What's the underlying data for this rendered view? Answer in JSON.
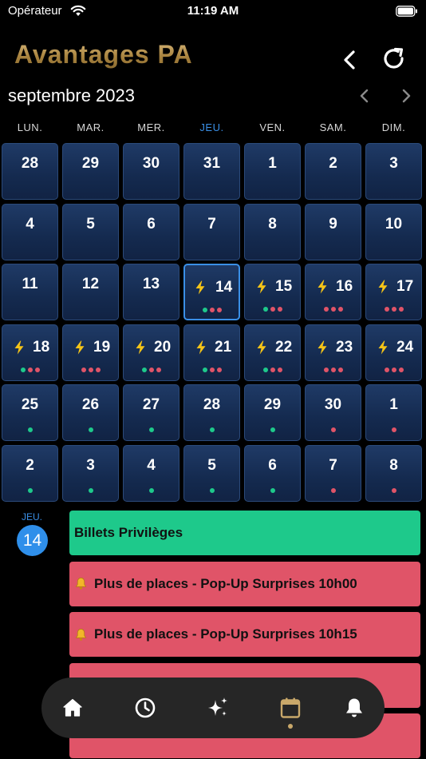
{
  "status": {
    "carrier": "Opérateur",
    "time": "11:19 AM"
  },
  "header": {
    "title": "Avantages PA"
  },
  "calendar": {
    "month_label": "septembre 2023",
    "weekdays": [
      "LUN.",
      "MAR.",
      "MER.",
      "JEU.",
      "VEN.",
      "SAM.",
      "DIM."
    ],
    "today_index": 3,
    "weeks": [
      [
        {
          "d": "28",
          "b": 0,
          "dots": []
        },
        {
          "d": "29",
          "b": 0,
          "dots": []
        },
        {
          "d": "30",
          "b": 0,
          "dots": []
        },
        {
          "d": "31",
          "b": 0,
          "dots": []
        },
        {
          "d": "1",
          "b": 0,
          "dots": []
        },
        {
          "d": "2",
          "b": 0,
          "dots": []
        },
        {
          "d": "3",
          "b": 0,
          "dots": []
        }
      ],
      [
        {
          "d": "4",
          "b": 0,
          "dots": []
        },
        {
          "d": "5",
          "b": 0,
          "dots": []
        },
        {
          "d": "6",
          "b": 0,
          "dots": []
        },
        {
          "d": "7",
          "b": 0,
          "dots": []
        },
        {
          "d": "8",
          "b": 0,
          "dots": []
        },
        {
          "d": "9",
          "b": 0,
          "dots": []
        },
        {
          "d": "10",
          "b": 0,
          "dots": []
        }
      ],
      [
        {
          "d": "11",
          "b": 0,
          "dots": []
        },
        {
          "d": "12",
          "b": 0,
          "dots": []
        },
        {
          "d": "13",
          "b": 0,
          "dots": []
        },
        {
          "d": "14",
          "b": 1,
          "sel": 1,
          "dots": [
            "g",
            "r",
            "r"
          ]
        },
        {
          "d": "15",
          "b": 1,
          "dots": [
            "g",
            "r",
            "r"
          ]
        },
        {
          "d": "16",
          "b": 1,
          "dots": [
            "r",
            "r",
            "r"
          ]
        },
        {
          "d": "17",
          "b": 1,
          "dots": [
            "r",
            "r",
            "r"
          ]
        }
      ],
      [
        {
          "d": "18",
          "b": 1,
          "dots": [
            "g",
            "r",
            "r"
          ]
        },
        {
          "d": "19",
          "b": 1,
          "dots": [
            "r",
            "r",
            "r"
          ]
        },
        {
          "d": "20",
          "b": 1,
          "dots": [
            "g",
            "r",
            "r"
          ]
        },
        {
          "d": "21",
          "b": 1,
          "dots": [
            "g",
            "r",
            "r"
          ]
        },
        {
          "d": "22",
          "b": 1,
          "dots": [
            "g",
            "r",
            "r"
          ]
        },
        {
          "d": "23",
          "b": 1,
          "dots": [
            "r",
            "r",
            "r"
          ]
        },
        {
          "d": "24",
          "b": 1,
          "dots": [
            "r",
            "r",
            "r"
          ]
        }
      ],
      [
        {
          "d": "25",
          "b": 0,
          "dots": [
            "g"
          ]
        },
        {
          "d": "26",
          "b": 0,
          "dots": [
            "g"
          ]
        },
        {
          "d": "27",
          "b": 0,
          "dots": [
            "g"
          ]
        },
        {
          "d": "28",
          "b": 0,
          "dots": [
            "g"
          ]
        },
        {
          "d": "29",
          "b": 0,
          "dots": [
            "g"
          ]
        },
        {
          "d": "30",
          "b": 0,
          "dots": [
            "r"
          ]
        },
        {
          "d": "1",
          "b": 0,
          "dots": [
            "r"
          ]
        }
      ],
      [
        {
          "d": "2",
          "b": 0,
          "dots": [
            "g"
          ]
        },
        {
          "d": "3",
          "b": 0,
          "dots": [
            "g"
          ]
        },
        {
          "d": "4",
          "b": 0,
          "dots": [
            "g"
          ]
        },
        {
          "d": "5",
          "b": 0,
          "dots": [
            "g"
          ]
        },
        {
          "d": "6",
          "b": 0,
          "dots": [
            "g"
          ]
        },
        {
          "d": "7",
          "b": 0,
          "dots": [
            "r"
          ]
        },
        {
          "d": "8",
          "b": 0,
          "dots": [
            "r"
          ]
        }
      ]
    ]
  },
  "selected_day": {
    "weekday": "JEU.",
    "day": "14"
  },
  "events": [
    {
      "title": "Billets Privilèges",
      "color": "green",
      "icon": ""
    },
    {
      "title": "Plus de places - Pop-Up Surprises 10h00",
      "color": "red",
      "icon": "bell-icon"
    },
    {
      "title": "Plus de places - Pop-Up Surprises 10h15",
      "color": "red",
      "icon": "bell-icon"
    },
    {
      "title": "",
      "color": "red",
      "icon": ""
    },
    {
      "title": "",
      "color": "red",
      "icon": ""
    }
  ],
  "tabs": [
    {
      "name": "home-icon"
    },
    {
      "name": "clock-icon"
    },
    {
      "name": "sparkles-icon"
    },
    {
      "name": "calendar-icon",
      "active": true
    },
    {
      "name": "bell-icon"
    }
  ],
  "colors": {
    "accent_blue": "#3a8fe6",
    "dot_green": "#1ec98b",
    "dot_red": "#e05468",
    "gold": "#c9a86a",
    "tab_bar": "#262626"
  }
}
